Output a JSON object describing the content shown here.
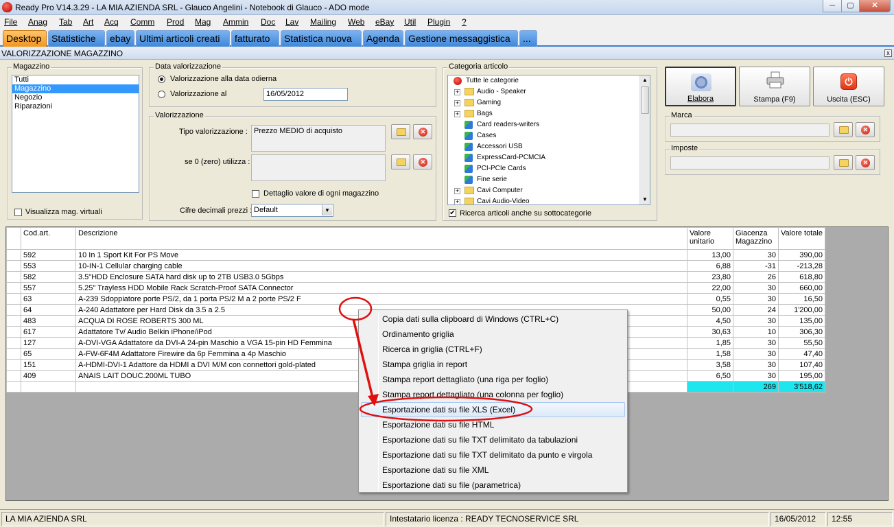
{
  "window": {
    "title": "Ready Pro V14.3.29 - LA MIA AZIENDA SRL - Glauco Angelini - Notebook di Glauco - ADO mode",
    "min": "─",
    "max": "▢",
    "close": "✕"
  },
  "menu": [
    "File",
    "Anag",
    "Tab",
    "Art",
    "Acq",
    "Comm",
    "Prod",
    "Mag",
    "Ammin",
    "Doc",
    "Lav",
    "Mailing",
    "Web",
    "eBay",
    "Util",
    "Plugin",
    "?"
  ],
  "tabs": [
    "Desktop",
    "Statistiche",
    "ebay",
    "Ultimi articoli creati",
    "fatturato",
    "Statistica nuova",
    "Agenda",
    "Gestione messaggistica",
    "..."
  ],
  "panel": {
    "title": "VALORIZZAZIONE MAGAZZINO",
    "close": "x"
  },
  "magazzino": {
    "label": "Magazzino",
    "items": [
      "Tutti",
      "Magazzino",
      "Negozio",
      "Riparazioni"
    ],
    "selected": 1,
    "virtual_label": "Visualizza mag. virtuali",
    "virtual_checked": false
  },
  "data_val": {
    "label": "Data valorizzazione",
    "opt_today": "Valorizzazione alla data odierna",
    "opt_at": "Valorizzazione al",
    "date": "16/05/2012",
    "selected": "today"
  },
  "valorizzazione": {
    "label": "Valorizzazione",
    "tipo_label": "Tipo valorizzazione :",
    "tipo_value": "Prezzo MEDIO di acquisto",
    "zero_label": "se 0 (zero) utilizza :",
    "zero_value": "",
    "dettaglio_label": "Dettaglio valore di ogni magazzino",
    "dettaglio_checked": false,
    "cifre_label": "Cifre decimali prezzi :",
    "cifre_value": "Default"
  },
  "categoria": {
    "label": "Categoria articolo",
    "root": "Tutte le categorie",
    "items": [
      {
        "name": "Audio - Speaker",
        "type": "folder",
        "expandable": true
      },
      {
        "name": "Gaming",
        "type": "folder",
        "expandable": true
      },
      {
        "name": "Bags",
        "type": "folder",
        "expandable": true
      },
      {
        "name": "Card readers-writers",
        "type": "node",
        "expandable": false
      },
      {
        "name": "Cases",
        "type": "node",
        "expandable": false
      },
      {
        "name": "Accessori USB",
        "type": "node",
        "expandable": false
      },
      {
        "name": "ExpressCard-PCMCIA",
        "type": "node",
        "expandable": false
      },
      {
        "name": "PCI-PCIe Cards",
        "type": "node",
        "expandable": false
      },
      {
        "name": "Fine serie",
        "type": "node",
        "expandable": false
      },
      {
        "name": "Cavi Computer",
        "type": "folder",
        "expandable": true
      },
      {
        "name": "Cavi Audio-Video",
        "type": "folder",
        "expandable": true
      }
    ],
    "subcat_label": "Ricerca articoli anche su sottocategorie",
    "subcat_checked": true
  },
  "buttons": {
    "elabora": "Elabora",
    "stampa": "Stampa (F9)",
    "uscita": "Uscita (ESC)"
  },
  "marca": {
    "label": "Marca",
    "value": ""
  },
  "imposte": {
    "label": "Imposte",
    "value": ""
  },
  "grid": {
    "headers": [
      "",
      "Cod.art.",
      "Descrizione",
      "Valore\nunitario",
      "Giacenza\nMagazzino",
      "Valore totale"
    ],
    "rows": [
      [
        "592",
        "10 In 1 Sport Kit For PS Move",
        "13,00",
        "30",
        "390,00"
      ],
      [
        "553",
        "10-IN-1 Cellular charging cable",
        "6,88",
        "-31",
        "-213,28"
      ],
      [
        "582",
        "3.5\"HDD Enclosure SATA hard disk up to 2TB USB3.0 5Gbps",
        "23,80",
        "26",
        "618,80"
      ],
      [
        "557",
        "5.25\" Trayless HDD Mobile Rack Scratch-Proof SATA Connector",
        "22,00",
        "30",
        "660,00"
      ],
      [
        "63",
        "A-239 Sdoppiatore porte PS/2, da 1 porta PS/2 M a 2 porte PS/2 F",
        "0,55",
        "30",
        "16,50"
      ],
      [
        "64",
        "A-240 Adattatore per Hard Disk da 3.5 a 2.5",
        "50,00",
        "24",
        "1'200,00"
      ],
      [
        "483",
        "ACQUA DI ROSE ROBERTS 300 ML",
        "4,50",
        "30",
        "135,00"
      ],
      [
        "617",
        "Adattatore Tv/ Audio Belkin iPhone/iPod",
        "30,63",
        "10",
        "306,30"
      ],
      [
        "127",
        "A-DVI-VGA Adattatore da DVI-A 24-pin Maschio a VGA 15-pin HD Femmina",
        "1,85",
        "30",
        "55,50"
      ],
      [
        "65",
        "A-FW-6F4M Adattatore Firewire da 6p Femmina a 4p Maschio",
        "1,58",
        "30",
        "47,40"
      ],
      [
        "151",
        "A-HDMI-DVI-1 Adattore da HDMI a DVI M/M con connettori gold-plated",
        "3,58",
        "30",
        "107,40"
      ],
      [
        "409",
        "ANAIS LAIT DOUC.200ML TUBO",
        "6,50",
        "30",
        "195,00"
      ]
    ],
    "total": {
      "giacenza": "269",
      "valore": "3'518,62"
    }
  },
  "context_menu": {
    "items": [
      "Copia dati sulla clipboard di Windows (CTRL+C)",
      "Ordinamento griglia",
      "Ricerca in griglia (CTRL+F)",
      "Stampa griglia in report",
      "Stampa report dettagliato (una riga per foglio)",
      "Stampa report dettagliato (una colonna per foglio)",
      "Esportazione dati su file XLS (Excel)",
      "Esportazione dati su file HTML",
      "Esportazione dati su file TXT delimitato da tabulazioni",
      "Esportazione dati su file TXT delimitato da punto e virgola",
      "Esportazione dati su file XML",
      "Esportazione dati su file (parametrica)"
    ],
    "highlighted": 6
  },
  "status": {
    "company": "LA MIA AZIENDA SRL",
    "license": "Intestatario licenza : READY TECNOSERVICE SRL",
    "date": "16/05/2012",
    "time": "12:55"
  },
  "colors": {
    "accent": "#3a7fd8",
    "active_tab": "#f2951e",
    "total_highlight": "#1ee6ef",
    "annotation": "#e01010"
  }
}
